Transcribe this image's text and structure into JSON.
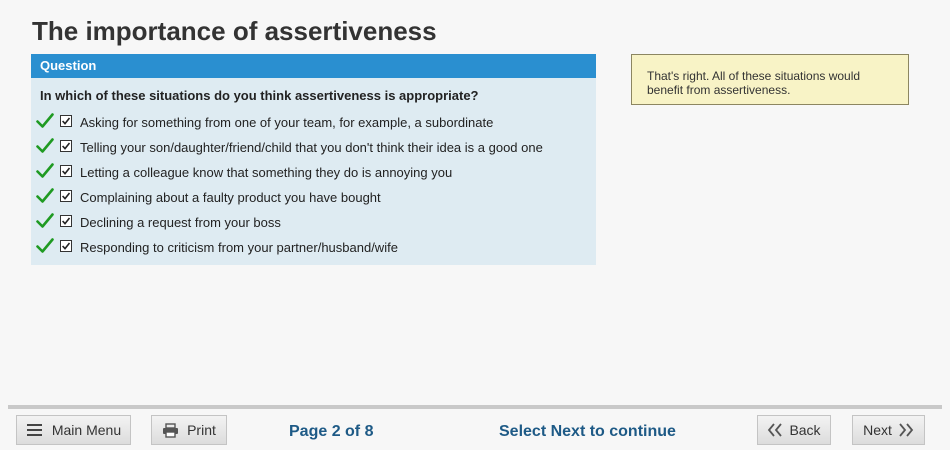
{
  "page": {
    "title": "The importance of assertiveness"
  },
  "question": {
    "header": "Question",
    "prompt": "In which of these situations do you think assertiveness is appropriate?",
    "options": [
      {
        "label": "Asking for something from one of your team, for example, a subordinate",
        "checked": true,
        "correct": true
      },
      {
        "label": "Telling your son/daughter/friend/child that you don't think their idea is a good one",
        "checked": true,
        "correct": true
      },
      {
        "label": "Letting a colleague know that something they do is annoying you",
        "checked": true,
        "correct": true
      },
      {
        "label": "Complaining about a faulty product you have bought",
        "checked": true,
        "correct": true
      },
      {
        "label": "Declining a request from your boss",
        "checked": true,
        "correct": true
      },
      {
        "label": "Responding to criticism from your partner/husband/wife",
        "checked": true,
        "correct": true
      }
    ]
  },
  "feedback": {
    "text": "That's right. All of these situations would benefit from assertiveness."
  },
  "footer": {
    "main_menu_label": "Main Menu",
    "print_label": "Print",
    "page_indicator": "Page 2 of 8",
    "status_message": "Select Next to continue",
    "back_label": "Back",
    "next_label": "Next"
  },
  "colors": {
    "header_blue": "#2a8fd0",
    "panel_bg": "#deebf2",
    "tick_green": "#1f9a22",
    "feedback_bg": "#f8f3c6",
    "status_text": "#1e5a86"
  },
  "icons": {
    "correct": "check-icon",
    "menu": "hamburger-icon",
    "print": "printer-icon",
    "back": "double-chevron-left-icon",
    "next": "double-chevron-right-icon"
  }
}
